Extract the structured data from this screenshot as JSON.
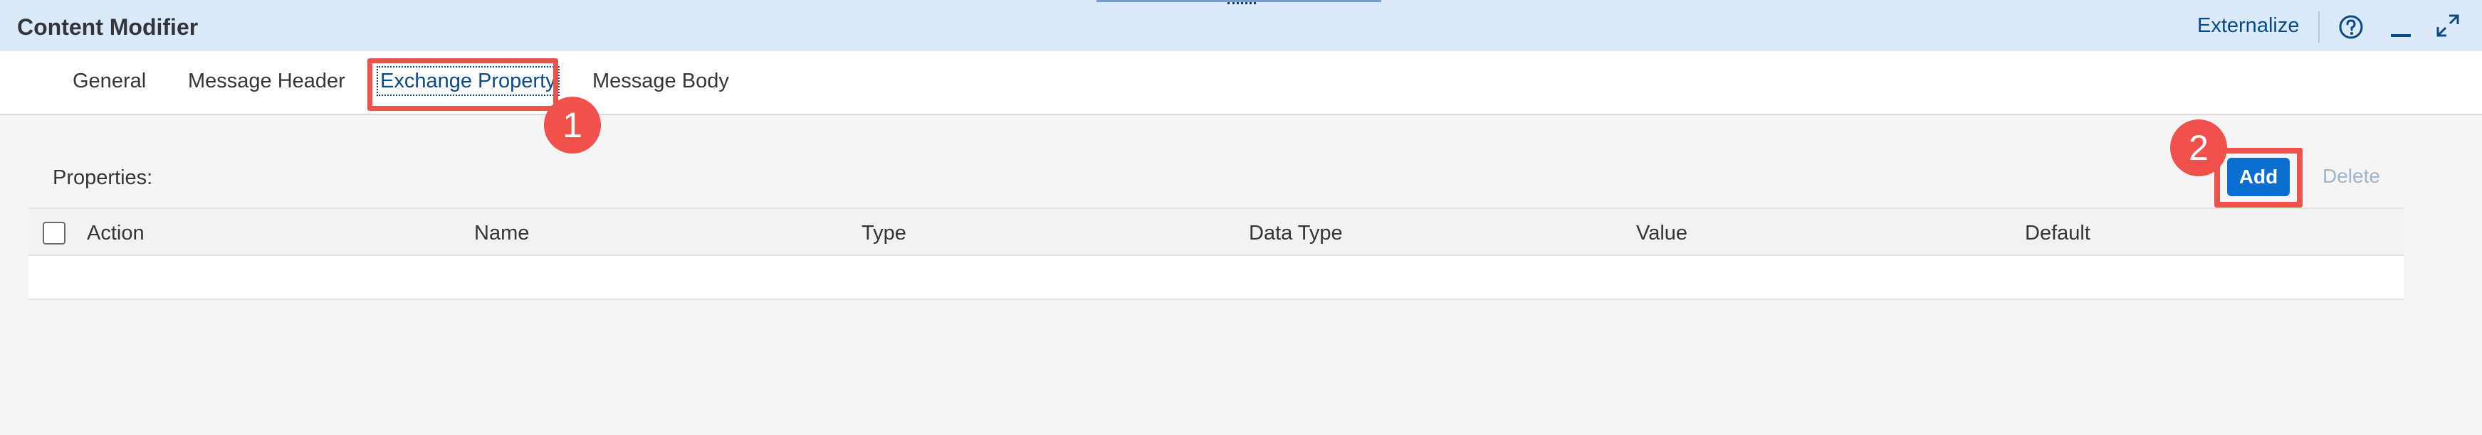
{
  "window": {
    "title": "Content Modifier",
    "externalize_label": "Externalize"
  },
  "tabs": [
    {
      "label": "General"
    },
    {
      "label": "Message Header"
    },
    {
      "label": "Exchange Property"
    },
    {
      "label": "Message Body"
    }
  ],
  "active_tab": "Exchange Property",
  "properties": {
    "label": "Properties:",
    "add_label": "Add",
    "delete_label": "Delete"
  },
  "table": {
    "columns": [
      "Action",
      "Name",
      "Type",
      "Data Type",
      "Value",
      "Default"
    ],
    "rows": []
  },
  "annotations": [
    {
      "number": "1"
    },
    {
      "number": "2"
    }
  ],
  "colors": {
    "header_bg": "#dbeafa",
    "accent": "#0a6ed1",
    "annotation": "#f0514a",
    "link": "#0a4a8a"
  },
  "icons": [
    "help-icon",
    "minimize-icon",
    "maximize-icon"
  ]
}
